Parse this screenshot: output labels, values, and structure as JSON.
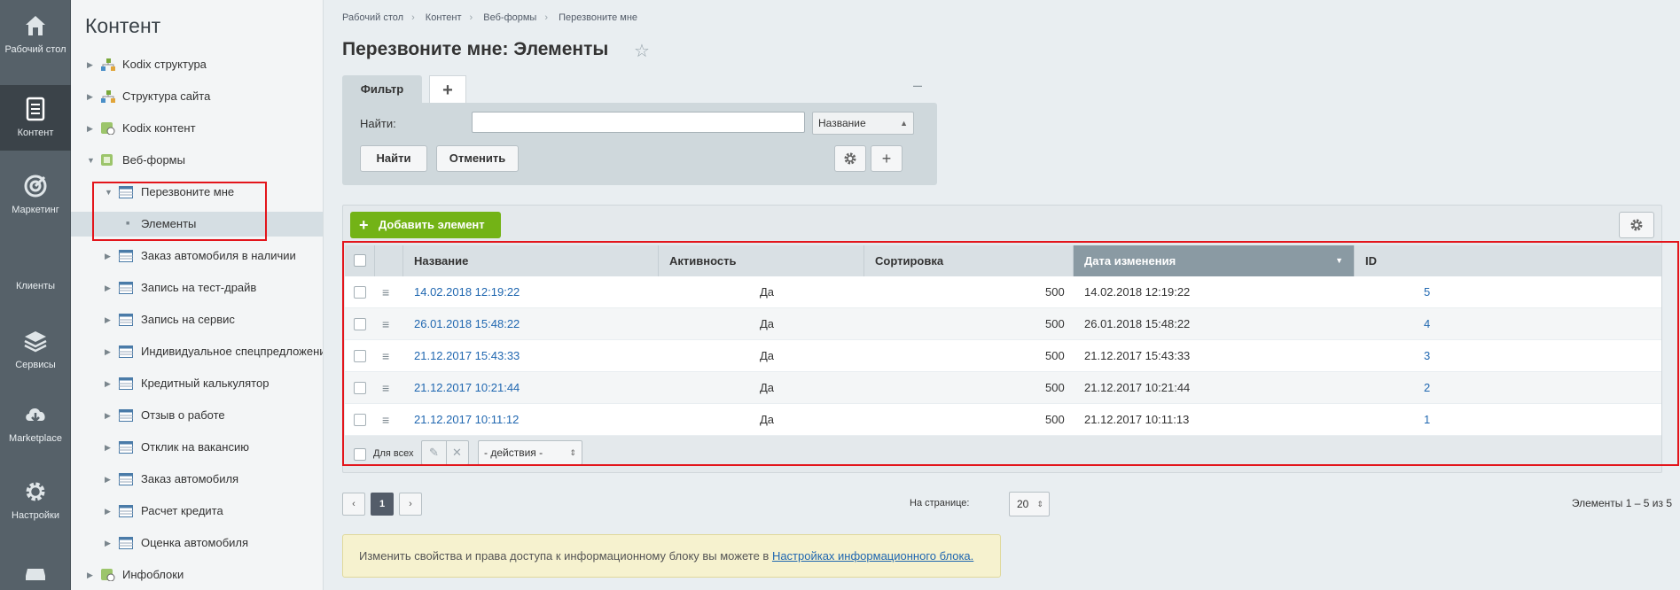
{
  "iconbar": {
    "items": [
      {
        "label": "Рабочий стол",
        "icon": "home-icon"
      },
      {
        "label": "Контент",
        "icon": "document-icon"
      },
      {
        "label": "Маркетинг",
        "icon": "target-icon"
      },
      {
        "label": "Клиенты",
        "icon": "clients-icon"
      },
      {
        "label": "Сервисы",
        "icon": "layers-icon"
      },
      {
        "label": "Marketplace",
        "icon": "cloud-download-icon"
      },
      {
        "label": "Настройки",
        "icon": "gear-icon"
      }
    ]
  },
  "tree": {
    "title": "Контент",
    "items": [
      {
        "label": "Kodix структура"
      },
      {
        "label": "Структура сайта"
      },
      {
        "label": "Kodix контент"
      },
      {
        "label": "Веб-формы"
      },
      {
        "label": "Перезвоните мне"
      },
      {
        "label": "Элементы"
      },
      {
        "label": "Заказ автомобиля в наличии"
      },
      {
        "label": "Запись на тест-драйв"
      },
      {
        "label": "Запись на сервис"
      },
      {
        "label": "Индивидуальное спецпредложени"
      },
      {
        "label": "Кредитный калькулятор"
      },
      {
        "label": "Отзыв о работе"
      },
      {
        "label": "Отклик на вакансию"
      },
      {
        "label": "Заказ автомобиля"
      },
      {
        "label": "Расчет кредита"
      },
      {
        "label": "Оценка автомобиля"
      },
      {
        "label": "Инфоблоки"
      }
    ]
  },
  "breadcrumb": [
    "Рабочий стол",
    "Контент",
    "Веб-формы",
    "Перезвоните мне"
  ],
  "page_title": "Перезвоните мне: Элементы",
  "filter": {
    "tab_label": "Фильтр",
    "add_tab": "+",
    "collapse": "–",
    "find_label": "Найти:",
    "find_value": "",
    "field_select": "Название",
    "find_button": "Найти",
    "cancel_button": "Отменить"
  },
  "grid": {
    "add_button": "Добавить элемент",
    "columns": [
      "Название",
      "Активность",
      "Сортировка",
      "Дата изменения",
      "ID"
    ],
    "rows": [
      {
        "name": "14.02.2018 12:19:22",
        "active": "Да",
        "sort": "500",
        "modified": "14.02.2018 12:19:22",
        "id": "5"
      },
      {
        "name": "26.01.2018 15:48:22",
        "active": "Да",
        "sort": "500",
        "modified": "26.01.2018 15:48:22",
        "id": "4"
      },
      {
        "name": "21.12.2017 15:43:33",
        "active": "Да",
        "sort": "500",
        "modified": "21.12.2017 15:43:33",
        "id": "3"
      },
      {
        "name": "21.12.2017 10:21:44",
        "active": "Да",
        "sort": "500",
        "modified": "21.12.2017 10:21:44",
        "id": "2"
      },
      {
        "name": "21.12.2017 10:11:12",
        "active": "Да",
        "sort": "500",
        "modified": "21.12.2017 10:11:13",
        "id": "1"
      }
    ],
    "for_all": "Для всех",
    "actions_select": "- действия -"
  },
  "pager": {
    "prev": "‹",
    "current": "1",
    "next": "›",
    "per_page_label": "На странице:",
    "per_page_value": "20",
    "total": "Элементы 1 – 5 из 5"
  },
  "notice": {
    "text": "Изменить свойства и права доступа к информационному блоку вы можете в ",
    "link": "Настройках информационного блока."
  },
  "colors": {
    "accent_green": "#73b316",
    "link_blue": "#2067b0",
    "highlight_red": "#e3151b"
  }
}
